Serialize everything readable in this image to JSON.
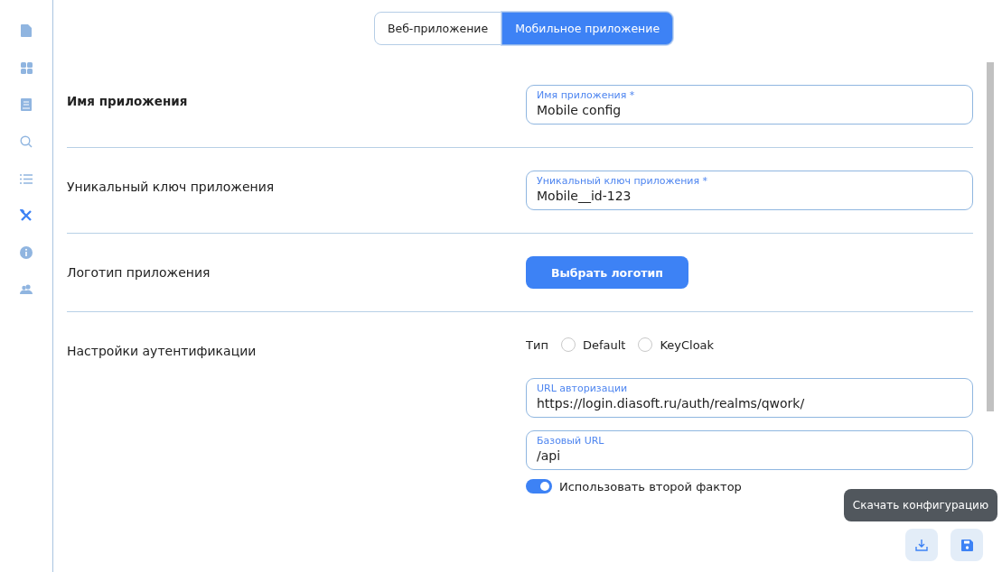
{
  "sidebar": {
    "items": [
      {
        "kind": "file",
        "selected": false
      },
      {
        "kind": "grid",
        "selected": false
      },
      {
        "kind": "book",
        "selected": false
      },
      {
        "kind": "search",
        "selected": false
      },
      {
        "kind": "list",
        "selected": false
      },
      {
        "kind": "tools",
        "selected": true
      },
      {
        "kind": "info",
        "selected": false
      },
      {
        "kind": "users",
        "selected": false
      }
    ]
  },
  "tabs": [
    {
      "label": "Веб-приложение",
      "selected": false
    },
    {
      "label": "Мобильное приложение",
      "selected": true
    }
  ],
  "sections": [
    {
      "label": "Имя приложения",
      "emphasized": true,
      "controls": [
        {
          "kind": "field",
          "label": "Имя приложения *",
          "value": "Mobile config"
        }
      ]
    },
    {
      "label": "Уникальный ключ приложения",
      "emphasized": false,
      "controls": [
        {
          "kind": "field",
          "label": "Уникальный ключ приложения *",
          "value": "Mobile__id-123"
        }
      ]
    },
    {
      "label": "Логотип приложения",
      "emphasized": false,
      "controls": [
        {
          "kind": "button",
          "label": "Выбрать логотип"
        }
      ]
    },
    {
      "label": "Настройки аутентификации",
      "emphasized": false,
      "controls": [
        {
          "kind": "radio",
          "label": "Тип",
          "options": [
            {
              "label": "Default",
              "selected": false
            },
            {
              "label": "KeyCloak",
              "selected": false
            }
          ]
        },
        {
          "kind": "field",
          "label": "URL авторизации",
          "value": "https://login.diasoft.ru/auth/realms/qwork/"
        },
        {
          "kind": "field",
          "label": "Базовый URL",
          "value": "/api"
        },
        {
          "kind": "toggle",
          "label": "Использовать второй фактор",
          "on": true
        }
      ]
    }
  ],
  "actions": [
    {
      "kind": "download",
      "tooltip": "Скачать конфигурацию"
    },
    {
      "kind": "save"
    }
  ]
}
